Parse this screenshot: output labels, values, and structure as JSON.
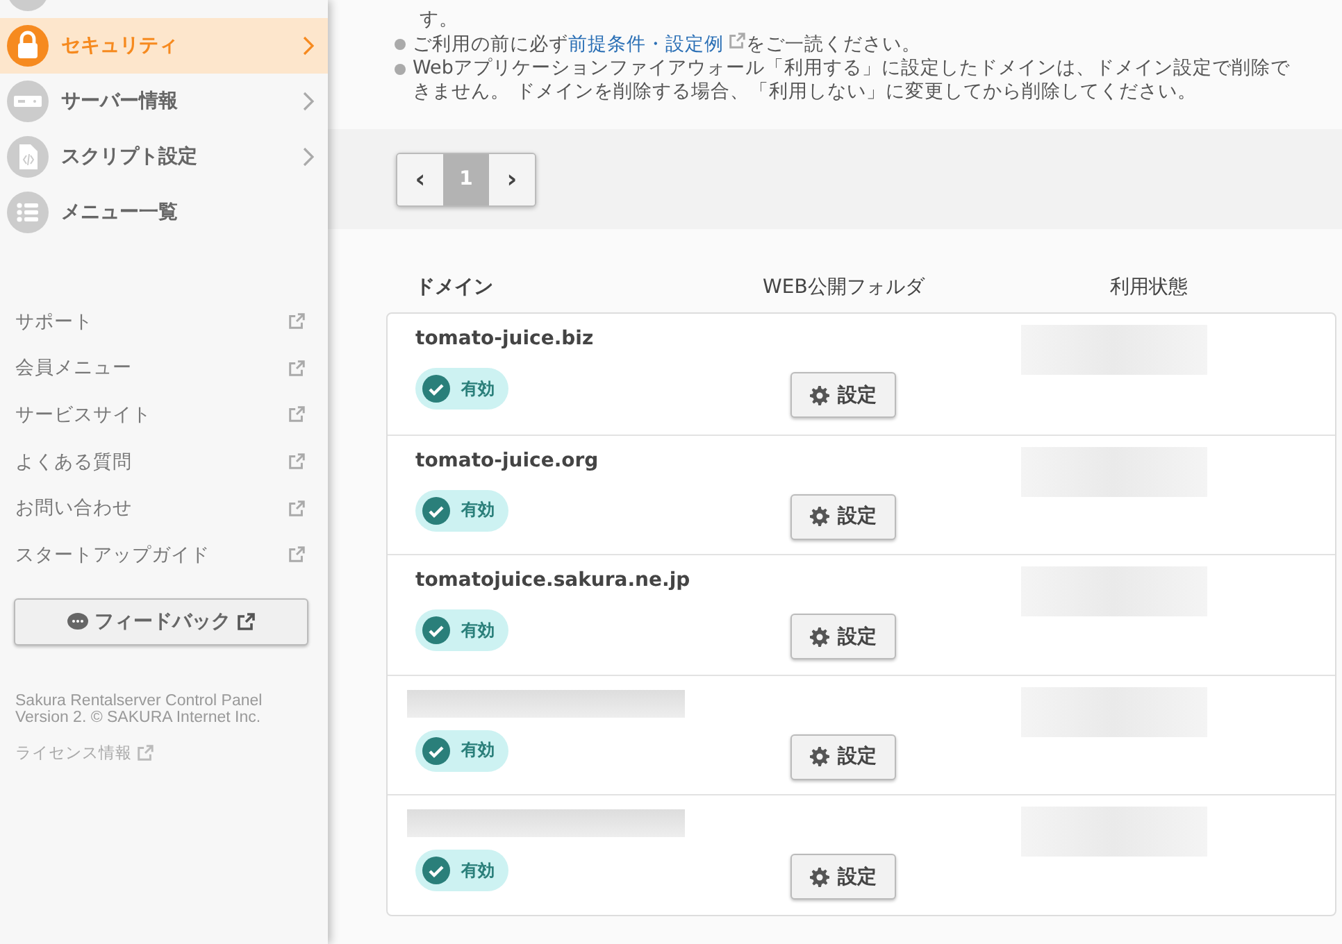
{
  "sidebar": {
    "nav_items": [
      {
        "label": "セキュリティ",
        "selected": true
      },
      {
        "label": "サーバー情報",
        "selected": false
      },
      {
        "label": "スクリプト設定",
        "selected": false
      },
      {
        "label": "メニュー一覧",
        "selected": false,
        "chevron": false
      }
    ],
    "links": [
      "サポート",
      "会員メニュー",
      "サービスサイト",
      "よくある質問",
      "お問い合わせ",
      "スタートアップガイド"
    ],
    "feedback_button": "フィードバック",
    "footer": [
      "Sakura Rentalserver Control Panel",
      "Version 2. © SAKURA Internet Inc."
    ],
    "license_link": "ライセンス情報"
  },
  "notice": {
    "continuation": "す。",
    "items": [
      {
        "before": "ご利用の前に必ず",
        "link": "前提条件・設定例",
        "after": "をご一読ください。"
      },
      {
        "before": "Webアプリケーションファイアウォール「利用する」に設定したドメインは、ドメイン設定で削除できません。 ドメインを削除する場合、「利用しない」に変更してから削除してください。"
      }
    ]
  },
  "pagination": {
    "prev": "‹",
    "pages": [
      {
        "label": "1",
        "selected": true
      }
    ],
    "next": "›"
  },
  "table": {
    "columns": [
      "ドメイン",
      "WEB公開フォルダ",
      "利用状態"
    ],
    "rows": [
      {
        "domain": "tomato-juice.biz",
        "status": "有効",
        "button": "設定"
      },
      {
        "domain": "tomato-juice.org",
        "status": "有効",
        "button": "設定"
      },
      {
        "domain": "tomatojuice.sakura.ne.jp",
        "status": "有効",
        "button": "設定"
      },
      {
        "status": "有効",
        "button": "設定"
      },
      {
        "status": "有効",
        "button": "設定"
      }
    ]
  }
}
